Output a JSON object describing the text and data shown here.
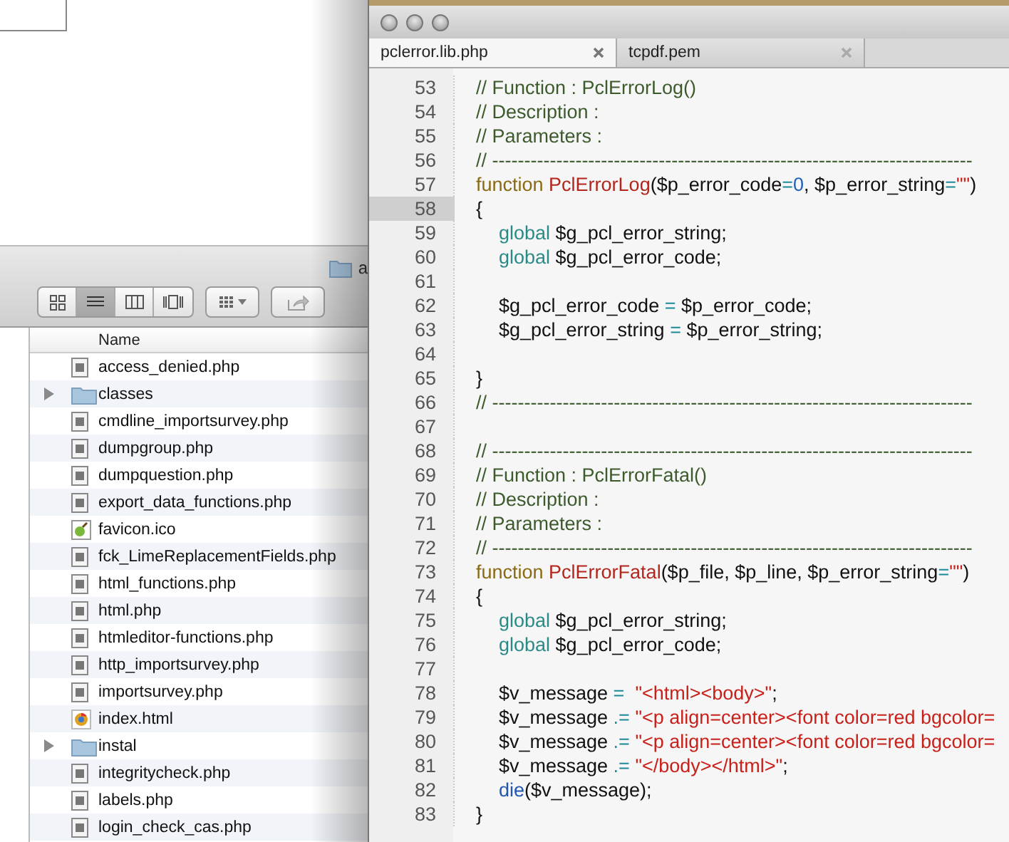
{
  "finder": {
    "path_title": "a",
    "toolbar": {
      "view_buttons": [
        {
          "kind": "icons",
          "selected": false
        },
        {
          "kind": "list",
          "selected": true
        },
        {
          "kind": "columns",
          "selected": false
        },
        {
          "kind": "coverflow",
          "selected": false
        }
      ]
    },
    "list": {
      "column_header": "Name",
      "rows": [
        {
          "name": "access_denied.php",
          "kind": "file"
        },
        {
          "name": "classes",
          "kind": "folder"
        },
        {
          "name": "cmdline_importsurvey.php",
          "kind": "file"
        },
        {
          "name": "dumpgroup.php",
          "kind": "file"
        },
        {
          "name": "dumpquestion.php",
          "kind": "file"
        },
        {
          "name": "export_data_functions.php",
          "kind": "file"
        },
        {
          "name": "favicon.ico",
          "kind": "image"
        },
        {
          "name": "fck_LimeReplacementFields.php",
          "kind": "file"
        },
        {
          "name": "html_functions.php",
          "kind": "file"
        },
        {
          "name": "html.php",
          "kind": "file"
        },
        {
          "name": "htmleditor-functions.php",
          "kind": "file"
        },
        {
          "name": "http_importsurvey.php",
          "kind": "file"
        },
        {
          "name": "importsurvey.php",
          "kind": "file"
        },
        {
          "name": "index.html",
          "kind": "html"
        },
        {
          "name": "instal",
          "kind": "folder"
        },
        {
          "name": "integritycheck.php",
          "kind": "file"
        },
        {
          "name": "labels.php",
          "kind": "file"
        },
        {
          "name": "login_check_cas.php",
          "kind": "file"
        }
      ]
    }
  },
  "editor": {
    "tabs": [
      {
        "label": "pclerror.lib.php",
        "selected": true
      },
      {
        "label": "tcpdf.pem",
        "selected": false
      }
    ],
    "lines": [
      {
        "number": "53",
        "current": false,
        "tokens": [
          {
            "kind": "comment",
            "text": "// Function : PclErrorLog()"
          }
        ]
      },
      {
        "number": "54",
        "current": false,
        "tokens": [
          {
            "kind": "comment",
            "text": "// Description :"
          }
        ]
      },
      {
        "number": "55",
        "current": false,
        "tokens": [
          {
            "kind": "comment",
            "text": "// Parameters :"
          }
        ]
      },
      {
        "number": "56",
        "current": false,
        "tokens": [
          {
            "kind": "comment",
            "text": "// ---------------------------------------------------------------------------"
          }
        ]
      },
      {
        "number": "57",
        "current": false,
        "tokens": [
          {
            "kind": "keyword",
            "text": "function "
          },
          {
            "kind": "name",
            "text": "PclErrorLog"
          },
          {
            "kind": "plain",
            "text": "($p_error_code"
          },
          {
            "kind": "operator",
            "text": "="
          },
          {
            "kind": "number",
            "text": "0"
          },
          {
            "kind": "plain",
            "text": ", $p_error_string"
          },
          {
            "kind": "operator",
            "text": "="
          },
          {
            "kind": "string",
            "text": "\"\""
          },
          {
            "kind": "plain",
            "text": ")"
          }
        ]
      },
      {
        "number": "58",
        "current": true,
        "tokens": [
          {
            "kind": "plain",
            "text": "{"
          }
        ]
      },
      {
        "number": "59",
        "current": false,
        "indented": true,
        "tokens": [
          {
            "kind": "builtin",
            "text": "global "
          },
          {
            "kind": "plain",
            "text": "$g_pcl_error_string;"
          }
        ]
      },
      {
        "number": "60",
        "current": false,
        "indented": true,
        "tokens": [
          {
            "kind": "builtin",
            "text": "global "
          },
          {
            "kind": "plain",
            "text": "$g_pcl_error_code;"
          }
        ]
      },
      {
        "number": "61",
        "current": false
      },
      {
        "number": "62",
        "current": false,
        "indented": true,
        "tokens": [
          {
            "kind": "plain",
            "text": "$g_pcl_error_code "
          },
          {
            "kind": "operator",
            "text": "="
          },
          {
            "kind": "plain",
            "text": " $p_error_code;"
          }
        ]
      },
      {
        "number": "63",
        "current": false,
        "indented": true,
        "tokens": [
          {
            "kind": "plain",
            "text": "$g_pcl_error_string "
          },
          {
            "kind": "operator",
            "text": "="
          },
          {
            "kind": "plain",
            "text": " $p_error_string;"
          }
        ]
      },
      {
        "number": "64",
        "current": false
      },
      {
        "number": "65",
        "current": false,
        "tokens": [
          {
            "kind": "plain",
            "text": "}"
          }
        ]
      },
      {
        "number": "66",
        "current": false,
        "tokens": [
          {
            "kind": "comment",
            "text": "// ---------------------------------------------------------------------------"
          }
        ]
      },
      {
        "number": "67",
        "current": false
      },
      {
        "number": "68",
        "current": false,
        "tokens": [
          {
            "kind": "comment",
            "text": "// ---------------------------------------------------------------------------"
          }
        ]
      },
      {
        "number": "69",
        "current": false,
        "tokens": [
          {
            "kind": "comment",
            "text": "// Function : PclErrorFatal()"
          }
        ]
      },
      {
        "number": "70",
        "current": false,
        "tokens": [
          {
            "kind": "comment",
            "text": "// Description :"
          }
        ]
      },
      {
        "number": "71",
        "current": false,
        "tokens": [
          {
            "kind": "comment",
            "text": "// Parameters :"
          }
        ]
      },
      {
        "number": "72",
        "current": false,
        "tokens": [
          {
            "kind": "comment",
            "text": "// ---------------------------------------------------------------------------"
          }
        ]
      },
      {
        "number": "73",
        "current": false,
        "tokens": [
          {
            "kind": "keyword",
            "text": "function "
          },
          {
            "kind": "name",
            "text": "PclErrorFatal"
          },
          {
            "kind": "plain",
            "text": "($p_file, $p_line, $p_error_string"
          },
          {
            "kind": "operator",
            "text": "="
          },
          {
            "kind": "string",
            "text": "\"\""
          },
          {
            "kind": "plain",
            "text": ")"
          }
        ]
      },
      {
        "number": "74",
        "current": false,
        "tokens": [
          {
            "kind": "plain",
            "text": "{"
          }
        ]
      },
      {
        "number": "75",
        "current": false,
        "indented": true,
        "tokens": [
          {
            "kind": "builtin",
            "text": "global "
          },
          {
            "kind": "plain",
            "text": "$g_pcl_error_string;"
          }
        ]
      },
      {
        "number": "76",
        "current": false,
        "indented": true,
        "tokens": [
          {
            "kind": "builtin",
            "text": "global "
          },
          {
            "kind": "plain",
            "text": "$g_pcl_error_code;"
          }
        ]
      },
      {
        "number": "77",
        "current": false
      },
      {
        "number": "78",
        "current": false,
        "indented": true,
        "tokens": [
          {
            "kind": "plain",
            "text": "$v_message "
          },
          {
            "kind": "operator",
            "text": "=  "
          },
          {
            "kind": "string",
            "text": "\"<html><body>\""
          },
          {
            "kind": "plain",
            "text": ";"
          }
        ]
      },
      {
        "number": "79",
        "current": false,
        "indented": true,
        "tokens": [
          {
            "kind": "plain",
            "text": "$v_message "
          },
          {
            "kind": "operator",
            "text": ".= "
          },
          {
            "kind": "string",
            "text": "\"<p align=center><font color=red bgcolor="
          }
        ]
      },
      {
        "number": "80",
        "current": false,
        "indented": true,
        "tokens": [
          {
            "kind": "plain",
            "text": "$v_message "
          },
          {
            "kind": "operator",
            "text": ".= "
          },
          {
            "kind": "string",
            "text": "\"<p align=center><font color=red bgcolor="
          }
        ]
      },
      {
        "number": "81",
        "current": false,
        "indented": true,
        "tokens": [
          {
            "kind": "plain",
            "text": "$v_message "
          },
          {
            "kind": "operator",
            "text": ".= "
          },
          {
            "kind": "string",
            "text": "\"</body></html>\""
          },
          {
            "kind": "plain",
            "text": ";"
          }
        ]
      },
      {
        "number": "82",
        "current": false,
        "indented": true,
        "tokens": [
          {
            "kind": "builtin2",
            "text": "die"
          },
          {
            "kind": "plain",
            "text": "($v_message);"
          }
        ]
      },
      {
        "number": "83",
        "current": false,
        "tokens": [
          {
            "kind": "plain",
            "text": "}"
          }
        ]
      }
    ]
  }
}
